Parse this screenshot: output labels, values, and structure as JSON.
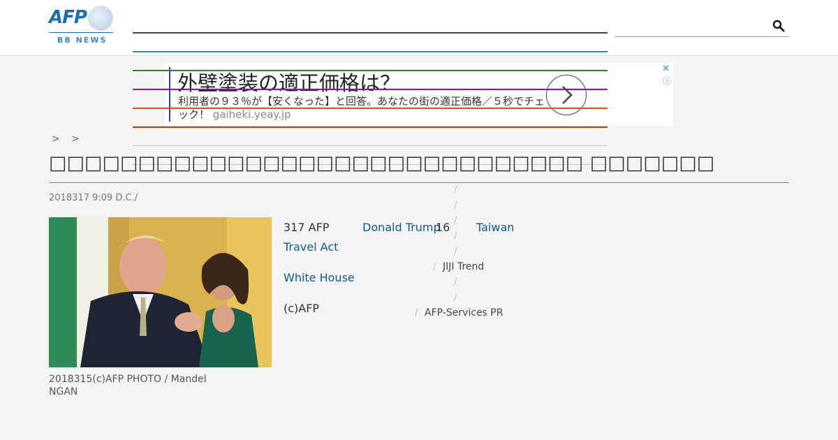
{
  "header": {
    "logo_text": "AFP",
    "logo_sub": "BB NEWS",
    "search_icon": "search-icon"
  },
  "colors": {
    "nav_lines": [
      "#444444",
      "#2a8ad0",
      "#2e7d32",
      "#7b1fa2",
      "#e65100",
      "#a84300"
    ],
    "accent": "#0e5a94",
    "ad_accent": "#3a3aa8"
  },
  "ad": {
    "title": "外壁塗装の適正価格は？",
    "body": "利用者の９３％が【安くなった】と回答。あなたの街の適正価格／５秒でチェック！",
    "url": "gaiheki.yeay.jp",
    "close_label": "✕",
    "info_label": "ⓘ",
    "arrow_icon": "chevron-right-icon"
  },
  "breadcrumb": {
    "text": "> >"
  },
  "article": {
    "title": "□□□□□□□□□□□□□□□□□□□□□□□□□□□□□□ □□□□□□□",
    "date": "2018317 9:09  D.C./",
    "photo_caption": "2018315(c)AFP PHOTO / Mandel NGAN",
    "text_1": "317 AFP",
    "link_1": "Donald Trump",
    "text_2": "16",
    "link_2": "Taiwan",
    "link_3": "Travel Act",
    "link_4": "White House",
    "text_3": "(c)AFP"
  },
  "side": {
    "slash": "/",
    "item_1": "JIJI Trend",
    "item_2": "AFP-Services PR"
  }
}
